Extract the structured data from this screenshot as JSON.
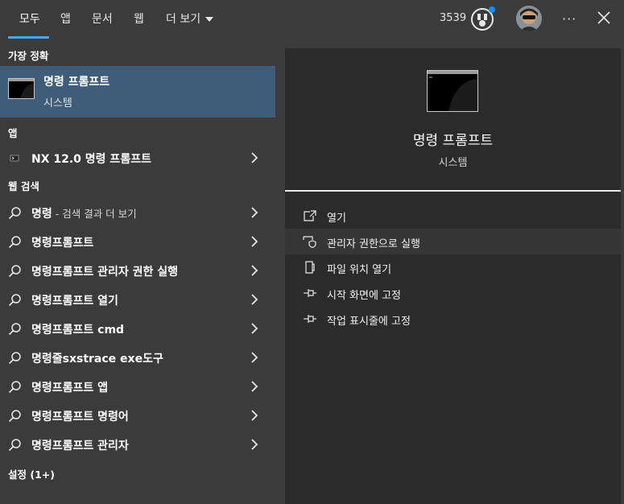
{
  "tabs": [
    {
      "label": "모두",
      "active": true
    },
    {
      "label": "앱"
    },
    {
      "label": "문서"
    },
    {
      "label": "웹"
    },
    {
      "label": "더 보기"
    }
  ],
  "header": {
    "points": "3539",
    "more_label": "···"
  },
  "best_match": {
    "section": "가장 정확",
    "title": "명령 프롬프트",
    "subtitle": "시스템"
  },
  "apps": {
    "section": "앱",
    "items": [
      {
        "label": "NX 12.0 명령 프롬프트"
      }
    ]
  },
  "web": {
    "section": "웹 검색",
    "items": [
      {
        "label": "명령",
        "sub": " - 검색 결과 더 보기"
      },
      {
        "label": "명령프롬프트"
      },
      {
        "label": "명령프롬프트 관리자 권한 실행"
      },
      {
        "label": "명령프롬프트 열기"
      },
      {
        "label": "명령프롬프트 cmd"
      },
      {
        "label": "명령줄sxstrace exe도구"
      },
      {
        "label": "명령프롬프트 앱"
      },
      {
        "label": "명령프롬프트 명령어"
      },
      {
        "label": "명령프롬프트 관리자"
      }
    ]
  },
  "settings": {
    "section": "설정 (1+)"
  },
  "preview": {
    "title": "명령 프롬프트",
    "subtitle": "시스템",
    "actions": [
      {
        "label": "열기",
        "icon": "open-icon"
      },
      {
        "label": "관리자 권한으로 실행",
        "icon": "shield-icon"
      },
      {
        "label": "파일 위치 열기",
        "icon": "file-location-icon"
      },
      {
        "label": "시작 화면에 고정",
        "icon": "pin-icon"
      },
      {
        "label": "작업 표시줄에 고정",
        "icon": "pin-icon"
      }
    ]
  },
  "colors": {
    "background": "#3b3b3b",
    "selected": "#3f5d78",
    "accent": "#4ca6e8",
    "preview_bg": "#2b2b2b"
  }
}
